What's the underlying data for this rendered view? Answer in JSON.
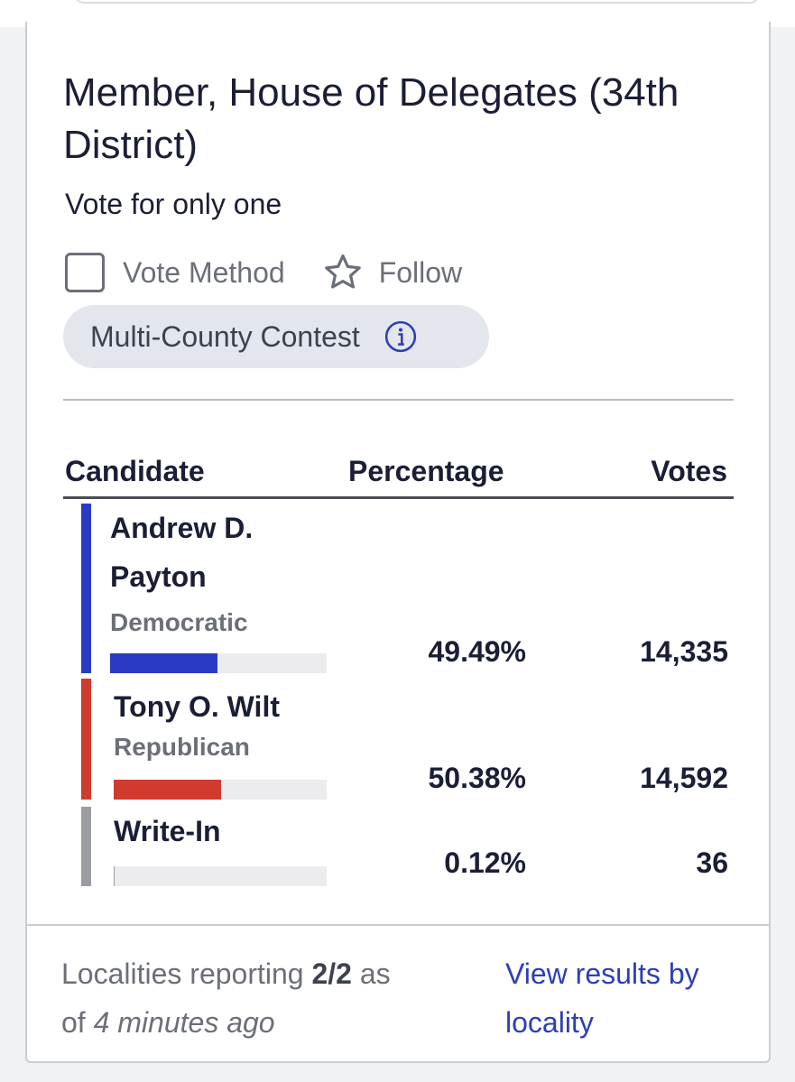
{
  "contest": {
    "title": "Member, House of Delegates (34th District)",
    "subtitle": "Vote for only one",
    "vote_method_label": "Vote Method",
    "follow_label": "Follow",
    "multi_county_label": "Multi-County Contest"
  },
  "table": {
    "headers": {
      "candidate": "Candidate",
      "percentage": "Percentage",
      "votes": "Votes"
    },
    "rows": [
      {
        "name": "Andrew D. Payton",
        "party": "Democratic",
        "percentage": "49.49%",
        "votes": "14,335",
        "share": 0.4949,
        "color": "#2a3ac4"
      },
      {
        "name": "Tony O. Wilt",
        "party": "Republican",
        "percentage": "50.38%",
        "votes": "14,592",
        "share": 0.5038,
        "color": "#d13a2e"
      },
      {
        "name": "Write-In",
        "party": "",
        "percentage": "0.12%",
        "votes": "36",
        "share": 0.0012,
        "color": "#9a9ca2"
      }
    ]
  },
  "footer": {
    "localities_prefix": "Localities reporting",
    "localities_count": "2/2",
    "as_of": "as",
    "of_word": "of",
    "time_ago": "4 minutes ago",
    "view_link": "View results by locality"
  },
  "colors": {
    "accent_link": "#2c3fb5",
    "democratic": "#2a3ac4",
    "republican": "#d13a2e",
    "write_in": "#9a9ca2"
  },
  "icons": {
    "checkbox": "checkbox-icon",
    "star": "star-icon",
    "info": "info-icon"
  }
}
